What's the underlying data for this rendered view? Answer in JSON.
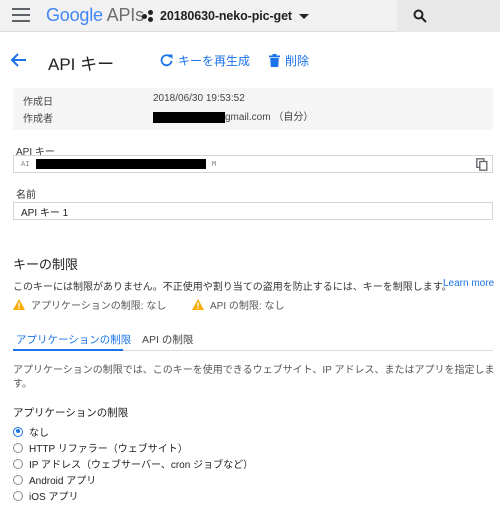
{
  "topbar": {
    "logo_google": "Google",
    "logo_apis": "APIs",
    "project_name": "20180630-neko-pic-get"
  },
  "header": {
    "title": "API キー",
    "regenerate_label": "キーを再生成",
    "delete_label": "削除"
  },
  "info": {
    "created_label": "作成日",
    "created_value": "2018/06/30 19:53:52",
    "creator_label": "作成者",
    "creator_suffix": "gmail.com （自分）"
  },
  "apikey": {
    "label": "API キー",
    "prefix": "AI",
    "suffix": "M"
  },
  "name_field": {
    "label": "名前",
    "value": "API キー 1"
  },
  "restrictions": {
    "title": "キーの制限",
    "description": "このキーには制限がありません。不正使用や割り当ての盗用を防止するには、キーを制限します。",
    "learn_more": "Learn more",
    "warn_app": "アプリケーションの制限: なし",
    "warn_api": "API の制限: なし"
  },
  "tabs": [
    {
      "label": "アプリケーションの制限",
      "active": true
    },
    {
      "label": "API の制限",
      "active": false
    }
  ],
  "app_restrictions": {
    "description": "アプリケーションの制限では、このキーを使用できるウェブサイト、IP アドレス、またはアプリを指定しま す。",
    "title": "アプリケーションの制限",
    "options": [
      {
        "label": "なし",
        "selected": true
      },
      {
        "label": "HTTP リファラー（ウェブサイト）",
        "selected": false
      },
      {
        "label": "IP アドレス（ウェブサーバー、cron ジョブなど）",
        "selected": false
      },
      {
        "label": "Android アプリ",
        "selected": false
      },
      {
        "label": "iOS アプリ",
        "selected": false
      }
    ]
  },
  "colors": {
    "accent": "#1a73e8",
    "warning": "#f9ab00",
    "topbar_bg": "#f1f1f1"
  },
  "icons": [
    "menu-icon",
    "project-dots-icon",
    "search-icon",
    "back-arrow-icon",
    "refresh-icon",
    "trash-icon",
    "copy-icon",
    "warning-icon"
  ]
}
